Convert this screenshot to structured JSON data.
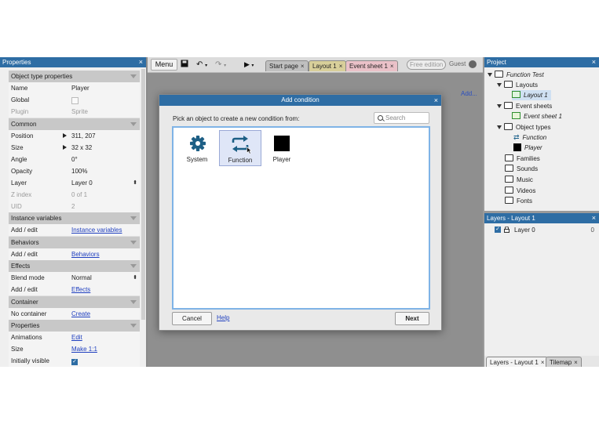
{
  "colors": {
    "titlebar": "#2e6da4",
    "link": "#1f3fbf",
    "category_bg": "#c8c8c8",
    "tab_layout": "#d8cf9a",
    "tab_event": "#eac1c8",
    "tab_start": "#bfbfbf"
  },
  "toolbar": {
    "menu_label": "Menu",
    "save_icon": "floppy-disk-icon",
    "undo_icon": "undo-icon",
    "redo_icon": "redo-icon",
    "play_icon": "play-icon",
    "tabs": [
      {
        "label": "Start page",
        "close": "×"
      },
      {
        "label": "Layout 1",
        "close": "×"
      },
      {
        "label": "Event sheet 1",
        "close": "×"
      }
    ],
    "edition_badge": "Free edition",
    "user": "Guest"
  },
  "workspace": {
    "add_link": "Add..."
  },
  "properties": {
    "title": "Properties",
    "close": "×",
    "rows": [
      {
        "k": "Object type properties",
        "cat": true
      },
      {
        "k": "Name",
        "v": "Player"
      },
      {
        "k": "Global",
        "v": ""
      },
      {
        "k": "Plugin",
        "v": "Sprite",
        "dis": true
      },
      {
        "k": "Common",
        "cat": true
      },
      {
        "k": "Position",
        "v": "311, 207"
      },
      {
        "k": "Size",
        "v": "32 x 32"
      },
      {
        "k": "Angle",
        "v": "0°"
      },
      {
        "k": "Opacity",
        "v": "100%"
      },
      {
        "k": "Layer",
        "v": "Layer 0"
      },
      {
        "k": "Z index",
        "v": "0 of 1",
        "dis": true
      },
      {
        "k": "UID",
        "v": "2",
        "dis": true
      },
      {
        "k": "Instance variables",
        "cat": true
      },
      {
        "k": "Add / edit",
        "v": "Instance variables",
        "link": true
      },
      {
        "k": "Behaviors",
        "cat": true
      },
      {
        "k": "Add / edit",
        "v": "Behaviors",
        "link": true
      },
      {
        "k": "Effects",
        "cat": true
      },
      {
        "k": "Blend mode",
        "v": "Normal"
      },
      {
        "k": "Add / edit",
        "v": "Effects",
        "link": true
      },
      {
        "k": "Container",
        "cat": true
      },
      {
        "k": "No container",
        "v": "Create",
        "link": true
      },
      {
        "k": "Properties",
        "cat": true
      },
      {
        "k": "Animations",
        "v": "Edit",
        "link": true
      },
      {
        "k": "Size",
        "v": "Make 1:1",
        "link": true
      },
      {
        "k": "Initially visible",
        "v": ""
      }
    ]
  },
  "project": {
    "title": "Project",
    "close": "×",
    "nodes": [
      {
        "label": "Function Test",
        "italic": true
      },
      {
        "label": "Layouts"
      },
      {
        "label": "Layout 1",
        "italic": true
      },
      {
        "label": "Event sheets"
      },
      {
        "label": "Event sheet 1",
        "italic": true
      },
      {
        "label": "Object types"
      },
      {
        "label": "Function",
        "italic": true
      },
      {
        "label": "Player",
        "italic": true
      },
      {
        "label": "Families"
      },
      {
        "label": "Sounds"
      },
      {
        "label": "Music"
      },
      {
        "label": "Videos"
      },
      {
        "label": "Fonts"
      }
    ]
  },
  "layers": {
    "title": "Layers - Layout 1",
    "close": "×",
    "rows": [
      {
        "name": "Layer 0",
        "index": "0"
      }
    ]
  },
  "bottom_tabs": [
    {
      "label": "Layers - Layout 1",
      "close": "×"
    },
    {
      "label": "Tilemap",
      "close": "×"
    }
  ],
  "dialog": {
    "title": "Add condition",
    "close": "×",
    "prompt": "Pick an object to create a new condition from:",
    "search_placeholder": "Search",
    "objects": [
      {
        "label": "System",
        "icon": "gear-icon"
      },
      {
        "label": "Function",
        "icon": "function-arrows-icon",
        "selected": true
      },
      {
        "label": "Player",
        "icon": "black-square-sprite"
      }
    ],
    "buttons": {
      "cancel": "Cancel",
      "help": "Help",
      "next": "Next"
    }
  }
}
